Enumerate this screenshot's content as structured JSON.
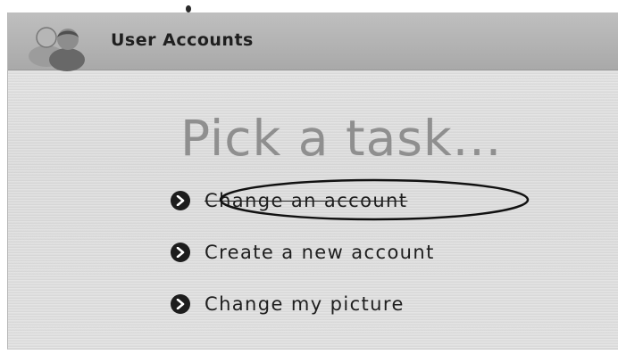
{
  "window": {
    "title": "User Accounts",
    "header_icon": "users-icon"
  },
  "main": {
    "heading": "Pick a task...",
    "tasks": [
      {
        "label": "Change an account",
        "icon": "arrow-right-circle-icon",
        "highlighted": true
      },
      {
        "label": "Create a new account",
        "icon": "arrow-right-circle-icon"
      },
      {
        "label": "Change my picture",
        "icon": "arrow-right-circle-icon"
      }
    ]
  },
  "colors": {
    "header": "#a9a9a9",
    "heading": "#8f8f8f",
    "text": "#1e1e1e",
    "bullet": "#1d1d1d"
  }
}
